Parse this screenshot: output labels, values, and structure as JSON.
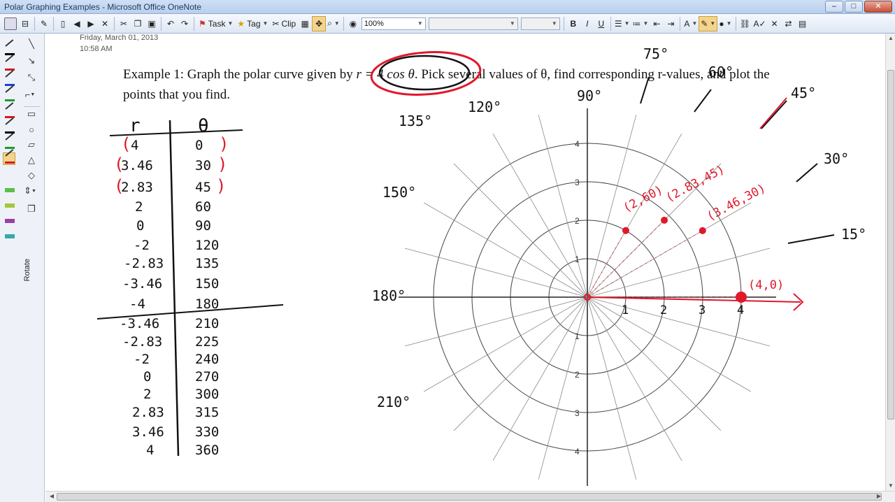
{
  "window": {
    "title": "Polar Graphing Examples - Microsoft Office OneNote",
    "buttons": [
      "minimize",
      "maximize",
      "close"
    ]
  },
  "toolbar": {
    "task_label": "Task",
    "tag_label": "Tag",
    "clip_label": "Clip",
    "zoom_value": "100%",
    "font_value": "",
    "size_value": ""
  },
  "left_pane": {
    "rotate_label": "Rotate"
  },
  "note": {
    "date": "Friday, March 01, 2013",
    "time": "10:58 AM",
    "prompt_a": "Example 1: Graph the polar curve given by ",
    "equation": "r = 4 cos θ",
    "prompt_b": ". Pick several values of θ, find corresponding r-values, and plot the points that you find."
  },
  "table": {
    "col_r": "r",
    "col_theta": "θ",
    "rows": [
      {
        "r": "4",
        "theta": "0"
      },
      {
        "r": "3.46",
        "theta": "30"
      },
      {
        "r": "2.83",
        "theta": "45"
      },
      {
        "r": "2",
        "theta": "60"
      },
      {
        "r": "0",
        "theta": "90"
      },
      {
        "r": "-2",
        "theta": "120"
      },
      {
        "r": "-2.83",
        "theta": "135"
      },
      {
        "r": "-3.46",
        "theta": "150"
      },
      {
        "r": "-4",
        "theta": "180"
      },
      {
        "r": "-3.46",
        "theta": "210"
      },
      {
        "r": "-2.83",
        "theta": "225"
      },
      {
        "r": "-2",
        "theta": "240"
      },
      {
        "r": "0",
        "theta": "270"
      },
      {
        "r": "2",
        "theta": "300"
      },
      {
        "r": "2.83",
        "theta": "315"
      },
      {
        "r": "3.46",
        "theta": "330"
      },
      {
        "r": "4",
        "theta": "360"
      }
    ]
  },
  "polar": {
    "angle_labels": [
      "75°",
      "60°",
      "90°",
      "45°",
      "120°",
      "135°",
      "30°",
      "150°",
      "15°",
      "180°",
      "210°"
    ],
    "radial_ticks_x": [
      "1",
      "2",
      "3",
      "4"
    ],
    "radial_ticks_y": [
      "4",
      "3",
      "2",
      "1",
      "1",
      "2",
      "3",
      "4"
    ],
    "plotted_points": [
      {
        "label": "(4,0)",
        "r": 4,
        "theta": 0
      },
      {
        "label": "(2,60)",
        "r": 2,
        "theta": 60
      },
      {
        "label": "(2.83,45)",
        "r": 2.83,
        "theta": 45
      },
      {
        "label": "(3.46,30)",
        "r": 3.46,
        "theta": 30
      }
    ],
    "ink_color": "#e0182b"
  }
}
